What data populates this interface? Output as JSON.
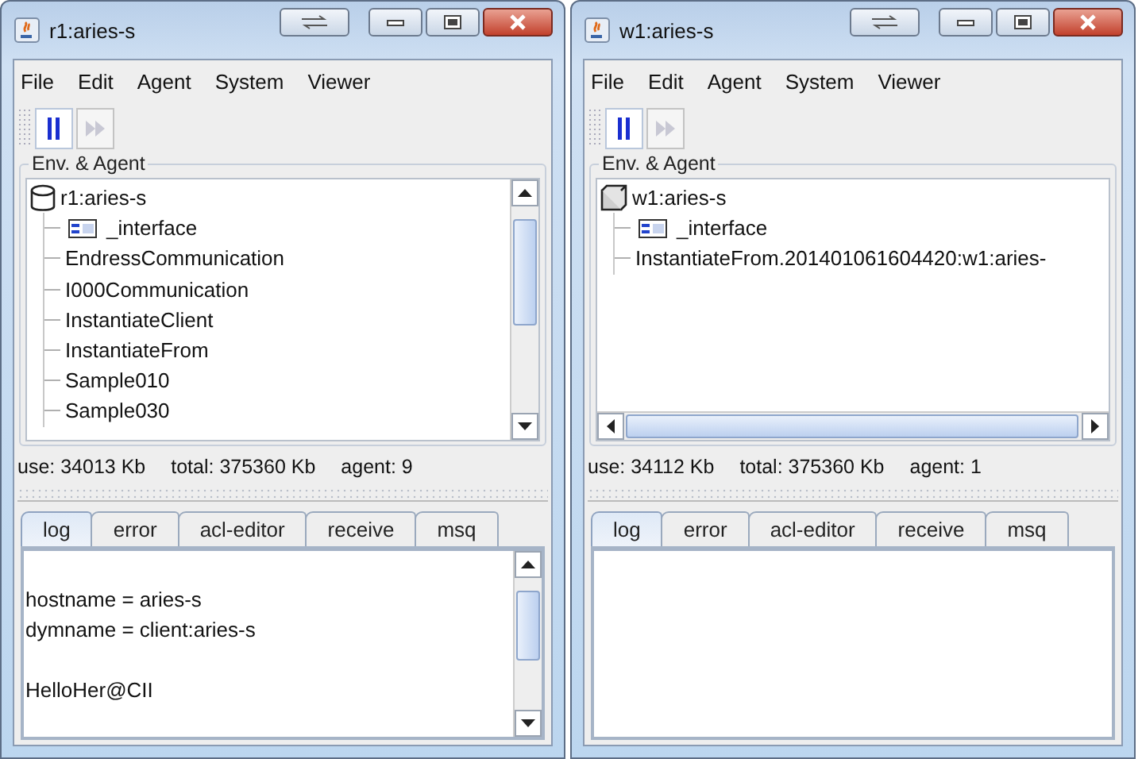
{
  "windows": [
    {
      "title": "r1:aries-s",
      "menu": [
        "File",
        "Edit",
        "Agent",
        "System",
        "Viewer"
      ],
      "toolbar": {
        "paused": true
      },
      "group_title": "Env. & Agent",
      "tree": {
        "label": "r1:aries-s",
        "kind": "cylinder",
        "vertical_scrollbar": true,
        "horizontal_scrollbar": false,
        "children": [
          {
            "label": "_interface",
            "kind": "interface"
          },
          {
            "label": "EndressCommunication",
            "kind": "plain"
          },
          {
            "label": "I000Communication",
            "kind": "plain"
          },
          {
            "label": "InstantiateClient",
            "kind": "plain"
          },
          {
            "label": "InstantiateFrom",
            "kind": "plain"
          },
          {
            "label": "Sample010",
            "kind": "plain"
          },
          {
            "label": "Sample030",
            "kind": "plain"
          }
        ]
      },
      "status": [
        "use: 34013 Kb",
        "total: 375360 Kb",
        "agent: 9"
      ],
      "tabs": [
        {
          "label": "log",
          "selected": true
        },
        {
          "label": "error",
          "selected": false
        },
        {
          "label": "acl-editor",
          "selected": false
        },
        {
          "label": "receive",
          "selected": false
        },
        {
          "label": "msq",
          "selected": false
        }
      ],
      "log": {
        "scrollbar": true,
        "lines": [
          {
            "text": "hostname = aries-s",
            "blank_before": true
          },
          {
            "text": "dymname = client:aries-s",
            "blank_before": false
          },
          {
            "text": "HelloHer@CII",
            "blank_before": true
          }
        ]
      }
    },
    {
      "title": "w1:aries-s",
      "menu": [
        "File",
        "Edit",
        "Agent",
        "System",
        "Viewer"
      ],
      "toolbar": {
        "paused": true
      },
      "group_title": "Env. & Agent",
      "tree": {
        "label": "w1:aries-s",
        "kind": "box",
        "vertical_scrollbar": false,
        "horizontal_scrollbar": true,
        "children": [
          {
            "label": "_interface",
            "kind": "interface"
          },
          {
            "label": "InstantiateFrom.201401061604420:w1:aries-",
            "kind": "plain"
          }
        ]
      },
      "status": [
        "use: 34112 Kb",
        "total: 375360 Kb",
        "agent: 1"
      ],
      "tabs": [
        {
          "label": "log",
          "selected": true
        },
        {
          "label": "error",
          "selected": false
        },
        {
          "label": "acl-editor",
          "selected": false
        },
        {
          "label": "receive",
          "selected": false
        },
        {
          "label": "msq",
          "selected": false
        }
      ],
      "log": {
        "scrollbar": false
      }
    }
  ]
}
